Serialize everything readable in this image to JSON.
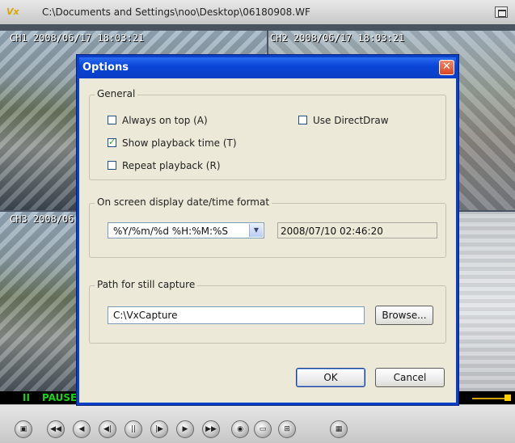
{
  "window": {
    "title": "C:\\Documents and Settings\\noo\\Desktop\\06180908.WF",
    "app_icon": "vx-app-icon"
  },
  "cameras": [
    {
      "label": "CH1 2008/06/17 18:03:21"
    },
    {
      "label": "CH2 2008/06/17 18:03:21"
    },
    {
      "label": "CH3 2008/06"
    },
    {
      "label": ""
    }
  ],
  "status": {
    "pause_symbol": "II",
    "pause_label": "PAUSE"
  },
  "controls": {
    "icons": [
      "snapshot-icon",
      "rewind-fast-icon",
      "rewind-icon",
      "step-back-icon",
      "pause-icon",
      "step-forward-icon",
      "play-icon",
      "forward-fast-icon",
      "capture-icon",
      "single-view-icon",
      "quad-view-icon",
      "grid-view-icon"
    ]
  },
  "dialog": {
    "title": "Options",
    "close_symbol": "✕",
    "general": {
      "title": "General",
      "always_on_top": {
        "label": "Always on top (A)",
        "checked": false
      },
      "use_directdraw": {
        "label": "Use DirectDraw",
        "checked": false
      },
      "show_playback_time": {
        "label": "Show playback time (T)",
        "checked": true
      },
      "repeat_playback": {
        "label": "Repeat playback (R)",
        "checked": false
      }
    },
    "osd": {
      "title": "On screen display date/time format",
      "format_value": "%Y/%m/%d %H:%M:%S",
      "preview_value": "2008/07/10 02:46:20"
    },
    "capture": {
      "title": "Path for still capture",
      "path_value": "C:\\VxCapture",
      "browse_label": "Browse..."
    },
    "ok_label": "OK",
    "cancel_label": "Cancel"
  },
  "colors": {
    "dialog_title_blue": "#0b46d8",
    "dialog_background": "#ece9d8",
    "pause_green": "#19d319",
    "close_red": "#d9461f"
  }
}
